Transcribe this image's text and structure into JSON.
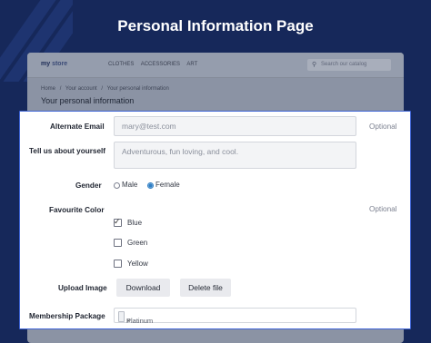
{
  "page_title": "Personal Information Page",
  "shop": {
    "logo_main": "my",
    "logo_store": " store",
    "nav": [
      "CLOTHES",
      "ACCESSORIES",
      "ART"
    ],
    "search_placeholder": "Search our catalog",
    "breadcrumb": [
      "Home",
      "/",
      "Your account",
      "/",
      "Your personal information"
    ],
    "heading": "Your personal information"
  },
  "form": {
    "alternate_email": {
      "label": "Alternate Email",
      "value": "mary@test.com",
      "optional": "Optional"
    },
    "about": {
      "label": "Tell us about yourself",
      "value": "Adventurous, fun loving, and cool."
    },
    "gender": {
      "label": "Gender",
      "options": [
        "Male",
        "Female"
      ],
      "selected": "Female"
    },
    "favourite_color": {
      "label": "Favourite Color",
      "optional": "Optional",
      "options": [
        {
          "label": "Blue",
          "checked": true
        },
        {
          "label": "Green",
          "checked": false
        },
        {
          "label": "Yellow",
          "checked": false
        }
      ]
    },
    "upload_image": {
      "label": "Upload Image",
      "download": "Download",
      "delete": "Delete file"
    },
    "membership": {
      "label": "Membership Package",
      "tag": "Platinum",
      "remove": "×"
    }
  },
  "colors": {
    "background": "#16285a",
    "accent": "#3e64d6",
    "radio_selected": "#2e7ec4"
  }
}
